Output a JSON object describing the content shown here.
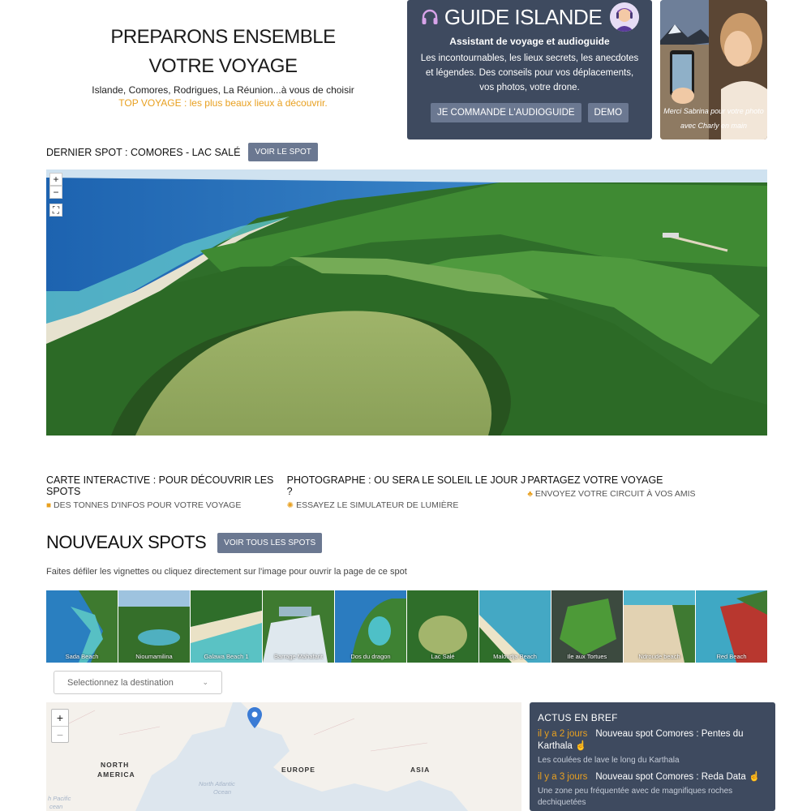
{
  "hero": {
    "title_line1": "PREPARONS ENSEMBLE",
    "title_line2": "VOTRE VOYAGE",
    "subtitle": "Islande, Comores, Rodrigues, La Réunion...à vous de choisir",
    "top_voyage": "TOP VOYAGE : les plus beaux lieux à découvrir."
  },
  "guide": {
    "title": "GUIDE ISLANDE",
    "subtitle": "Assistant de voyage et audioguide",
    "text": "Les incontournables, les lieux secrets, les anecdotes et légendes. Des conseils pour vos déplacements, vos photos, votre drone.",
    "order_button": "JE COMMANDE L'AUDIOGUIDE",
    "demo_button": "DEMO"
  },
  "photo_card": {
    "caption_line1": "Merci Sabrina pour votre photo",
    "caption_line2": "avec Charly en main"
  },
  "last_spot": {
    "label": "DERNIER SPOT : COMORES - LAC SALÉ",
    "button": "VOIR LE SPOT"
  },
  "pano": {
    "zoom_in": "+",
    "zoom_out": "−",
    "fullscreen": "⛶"
  },
  "features": [
    {
      "title": "CARTE INTERACTIVE : POUR DÉCOUVRIR LES SPOTS",
      "subtitle": "DES TONNES D'INFOS POUR VOTRE VOYAGE",
      "icon": "camera-icon"
    },
    {
      "title": "PHOTOGRAPHE : OU SERA LE SOLEIL LE JOUR J ?",
      "subtitle": "ESSAYEZ LE SIMULATEUR DE LUMIÈRE",
      "icon": "sun-icon"
    },
    {
      "title": "PARTAGEZ VOTRE VOYAGE",
      "subtitle": "ENVOYEZ VOTRE CIRCUIT À VOS AMIS",
      "icon": "share-icon"
    }
  ],
  "new_spots": {
    "title": "NOUVEAUX SPOTS",
    "button": "VOIR TOUS LES SPOTS",
    "description": "Faites défiler les vignettes ou cliquez directement sur l'image pour ouvrir la page de ce spot"
  },
  "thumbs": [
    "Sada Beach",
    "Nioumamilina",
    "Galawa Beach 1",
    "Barrage Mahafarit",
    "Dos du dragon",
    "Lac Salé",
    "Maloudja Beach",
    "Ile aux Tortues",
    "Ndroude beach",
    "Red Beach"
  ],
  "destination_select": {
    "placeholder": "Selectionnez la destination"
  },
  "map": {
    "zoom_in": "+",
    "zoom_out": "−",
    "labels": {
      "north_america_1": "NORTH",
      "north_america_2": "AMERICA",
      "europe": "EUROPE",
      "asia": "ASIA",
      "ocean_1": "North Atlantic",
      "ocean_2": "Ocean",
      "pacific_1": "h Pacific",
      "pacific_2": "cean"
    }
  },
  "news": {
    "title": "ACTUS EN BREF",
    "items": [
      {
        "time": "il y a 2 jours",
        "headline": "Nouveau spot Comores : Pentes du Karthala",
        "desc": "Les coulées de lave le long du Karthala"
      },
      {
        "time": "il y a 3 jours",
        "headline": "Nouveau spot Comores : Reda Data",
        "desc": "Une zone peu fréquentée avec de magnifiques roches dechiquetées"
      }
    ]
  }
}
